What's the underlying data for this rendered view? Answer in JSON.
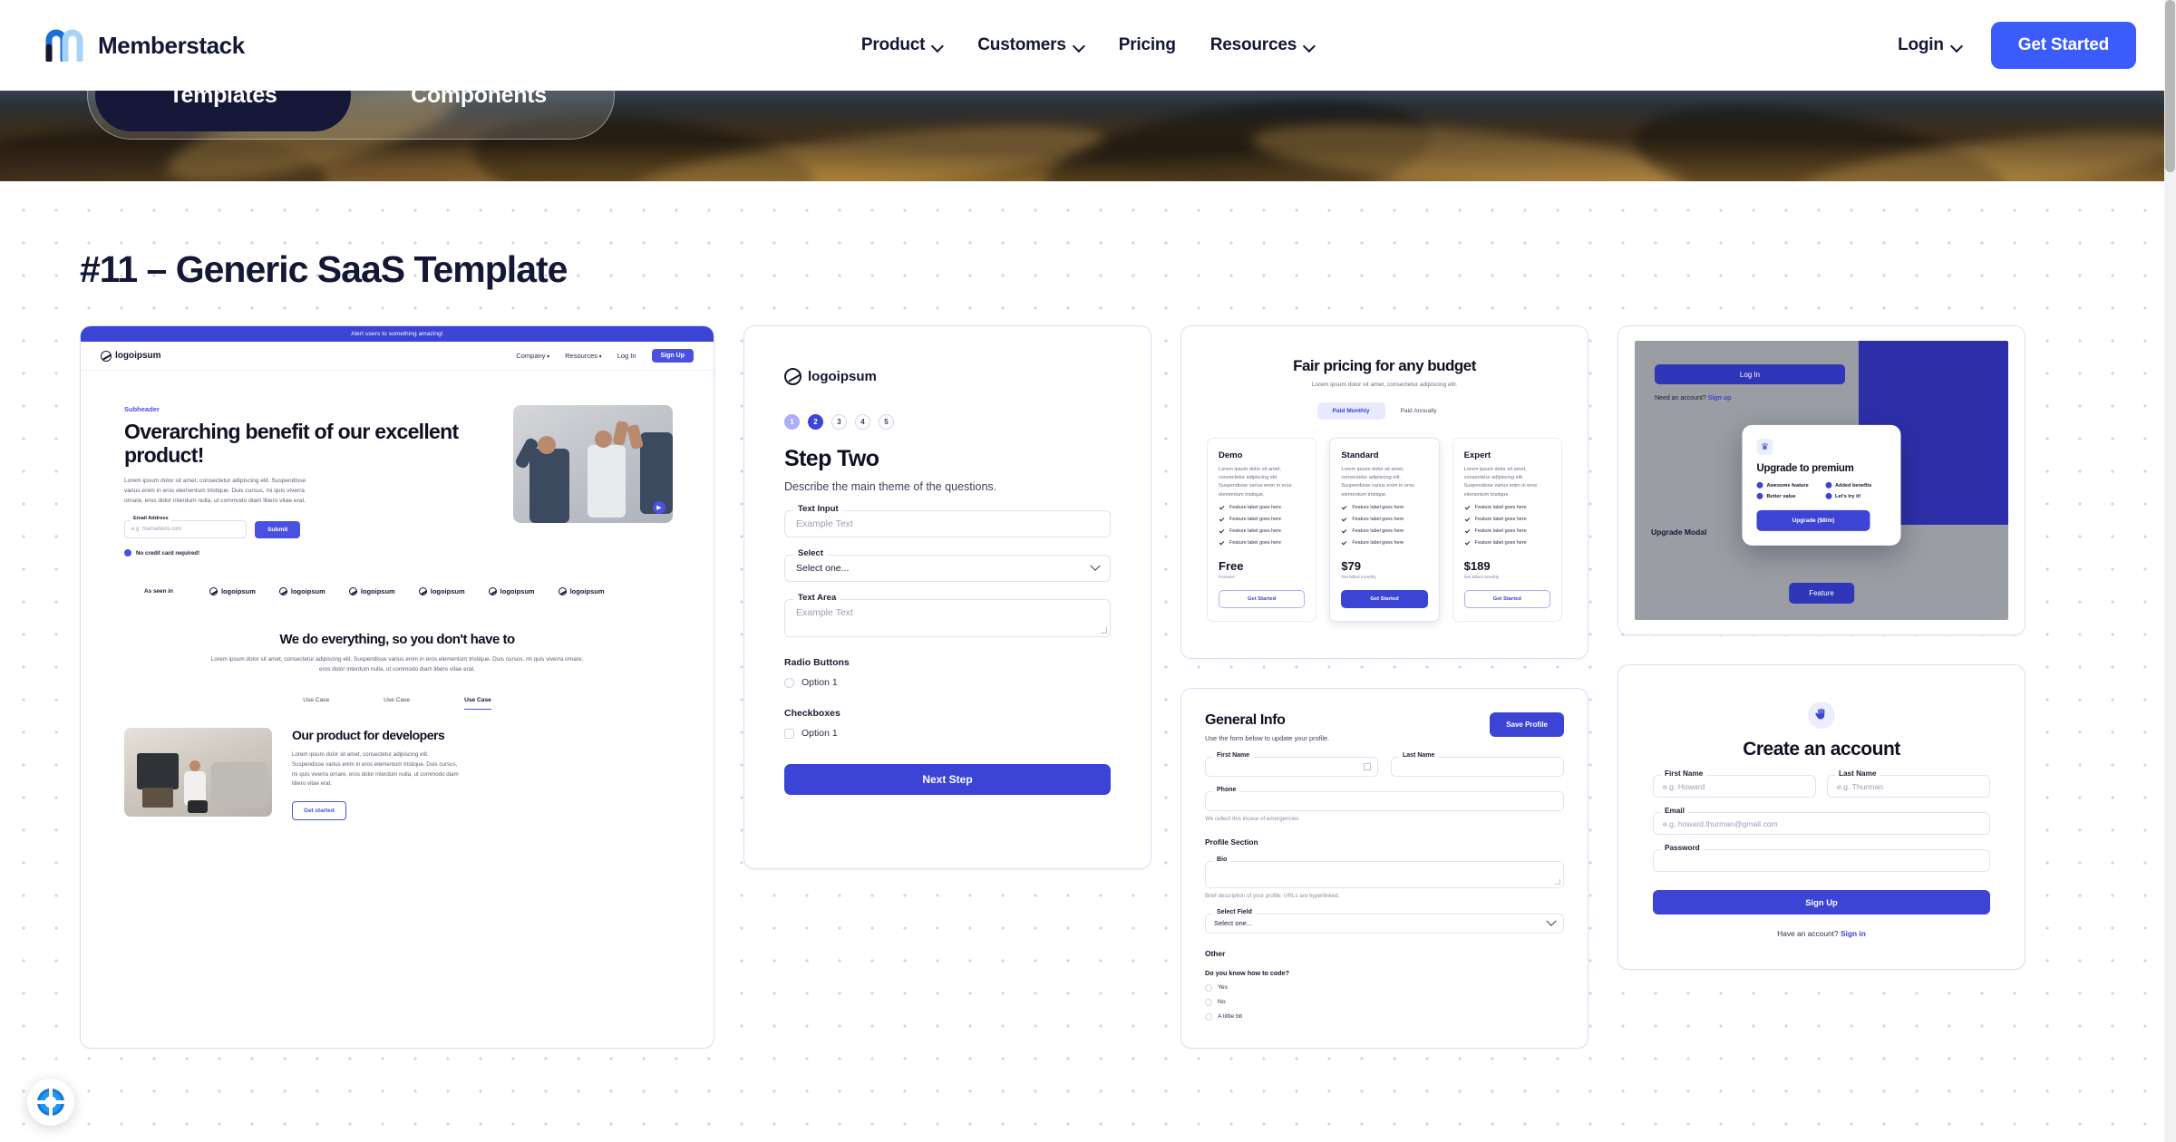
{
  "nav": {
    "brand": "Memberstack",
    "items": [
      {
        "label": "Product",
        "has_dropdown": true
      },
      {
        "label": "Customers",
        "has_dropdown": true
      },
      {
        "label": "Pricing",
        "has_dropdown": false
      },
      {
        "label": "Resources",
        "has_dropdown": true
      }
    ],
    "login": "Login",
    "cta": "Get Started"
  },
  "hero": {
    "tabs": [
      {
        "label": "Templates",
        "active": true
      },
      {
        "label": "Components",
        "active": false
      }
    ]
  },
  "page": {
    "title": "#11 – Generic SaaS Template"
  },
  "card_landing": {
    "banner": "Alert users to something amazing!",
    "logo": "logoipsum",
    "nav": [
      "Company",
      "Resources",
      "Log In"
    ],
    "signup": "Sign Up",
    "subheader": "Subheader",
    "heading": "Overarching benefit of our excellent product!",
    "paragraph": "Lorem ipsum dolor sit amet, consectetur adipiscing elit. Suspendisse varius enim in eros elementum tristique. Duis cursus, mi quis viverra ornare, eros dolor interdum nulla, ut commodo diam libero vitae erat.",
    "email_label": "Email Address",
    "email_placeholder": "e.g. mamadavis.com",
    "submit": "Submit",
    "no_credit_card": "No credit card required!",
    "as_seen_in": "As seen in",
    "logo_row": [
      "logoipsum",
      "logoipsum",
      "logoipsum",
      "logoipsum",
      "logoipsum",
      "logoipsum"
    ],
    "section2_heading": "We do everything, so you don't have to",
    "section2_paragraph": "Lorem ipsum dolor sit amet, consectetur adipiscing elit. Suspendisse varius enim in eros elementum tristique. Duis cursus, mi quis viverra ornare, eros dolor interdum nulla, ut commodo diam libero vitae erat.",
    "use_case_tabs": [
      "Use Case",
      "Use Case",
      "Use Case"
    ],
    "section3_heading": "Our product for developers",
    "section3_paragraph": "Lorem ipsum dolor sit amet, consectetur adipiscing elit. Suspendisse varius enim in eros elementum tristique. Duis cursus, mi quis viverra ornare, eros dolor interdum nulla, ut commodo diam libero vitae erat.",
    "section3_button": "Get started"
  },
  "card_step_form": {
    "logo": "logoipsum",
    "steps": [
      "1",
      "2",
      "3",
      "4",
      "5"
    ],
    "current_step": 2,
    "heading": "Step Two",
    "subheading": "Describe the main theme of the questions.",
    "text_input": {
      "label": "Text Input",
      "placeholder": "Example Text"
    },
    "select": {
      "label": "Select",
      "value": "Select one..."
    },
    "text_area": {
      "label": "Text Area",
      "placeholder": "Example Text"
    },
    "radio": {
      "label": "Radio Buttons",
      "option": "Option 1"
    },
    "checkbox": {
      "label": "Checkboxes",
      "option": "Option 1"
    },
    "cta": "Next Step"
  },
  "card_pricing": {
    "heading": "Fair pricing for any budget",
    "subheading": "Lorem ipsum dolor sit amet, consectetur adipiscing elit.",
    "toggle": [
      {
        "label": "Paid Monthly",
        "active": true
      },
      {
        "label": "Paid Annually",
        "active": false
      }
    ],
    "feature_label": "Feature label goes here",
    "tiers": [
      {
        "name": "Demo",
        "description": "Lorem ipsum dolor sit amet, consectetur adipiscing elit. Suspendisse varius enim in eros elementum tristique.",
        "features": [
          "Feature label goes here",
          "Feature label goes here",
          "Feature label goes here",
          "Feature label goes here"
        ],
        "price": "Free",
        "note": "Forever!",
        "button": "Get Started",
        "highlighted": false
      },
      {
        "name": "Standard",
        "description": "Lorem ipsum dolor sit amet, consectetur adipiscing elit. Suspendisse varius enim in eros elementum tristique.",
        "features": [
          "Feature label goes here",
          "Feature label goes here",
          "Feature label goes here",
          "Feature label goes here"
        ],
        "price": "$79",
        "note": "Get billed monthly",
        "button": "Get Started",
        "highlighted": true
      },
      {
        "name": "Expert",
        "description": "Lorem ipsum dolor sit amet, consectetur adipiscing elit. Suspendisse varius enim in eros elementum tristique.",
        "features": [
          "Feature label goes here",
          "Feature label goes here",
          "Feature label goes here",
          "Feature label goes here"
        ],
        "price": "$189",
        "note": "Get billed monthly",
        "button": "Get Started",
        "highlighted": false
      }
    ]
  },
  "card_upgrade_modal": {
    "login_button": "Log In",
    "need_account": "Need an account?",
    "need_account_link": "Sign up",
    "screen_label": "Upgrade Modal",
    "feature_button": "Feature",
    "modal": {
      "icon": "crown-icon",
      "heading": "Upgrade to premium",
      "features": [
        "Awesome feature",
        "Added benefits",
        "Better value",
        "Let's try it!"
      ],
      "button": "Upgrade ($8/m)"
    }
  },
  "card_general_info": {
    "heading": "General Info",
    "subheading": "Use the form below to update your profile.",
    "save_button": "Save Profile",
    "first_name_label": "First Name",
    "last_name_label": "Last Name",
    "phone_label": "Phone",
    "phone_hint": "We collect this incase of emergencies.",
    "profile_section": "Profile Section",
    "bio_label": "Bio",
    "bio_hint": "Brief description of your profile. URLs are hyperlinked.",
    "select_label": "Select Field",
    "select_value": "Select one...",
    "other_section": "Other",
    "question": "Do you know how to code?",
    "answers": [
      "Yes",
      "No",
      "A little bit"
    ]
  },
  "card_create_account": {
    "icon": "wave-hand-icon",
    "heading": "Create an account",
    "first_name": {
      "label": "First Name",
      "placeholder": "e.g. Howard"
    },
    "last_name": {
      "label": "Last Name",
      "placeholder": "e.g. Thurman"
    },
    "email": {
      "label": "Email",
      "placeholder": "e.g. howard.thurman@gmail.com"
    },
    "password": {
      "label": "Password",
      "placeholder": ""
    },
    "button": "Sign Up",
    "footer": "Have an account?",
    "footer_link": "Sign in"
  },
  "support_widget": {
    "icon": "lifebuoy-icon"
  },
  "colors": {
    "brand_blue": "#3b5bfd",
    "template_blue": "#3b44d5",
    "ink": "#141735",
    "hero_dark": "#16183a"
  }
}
